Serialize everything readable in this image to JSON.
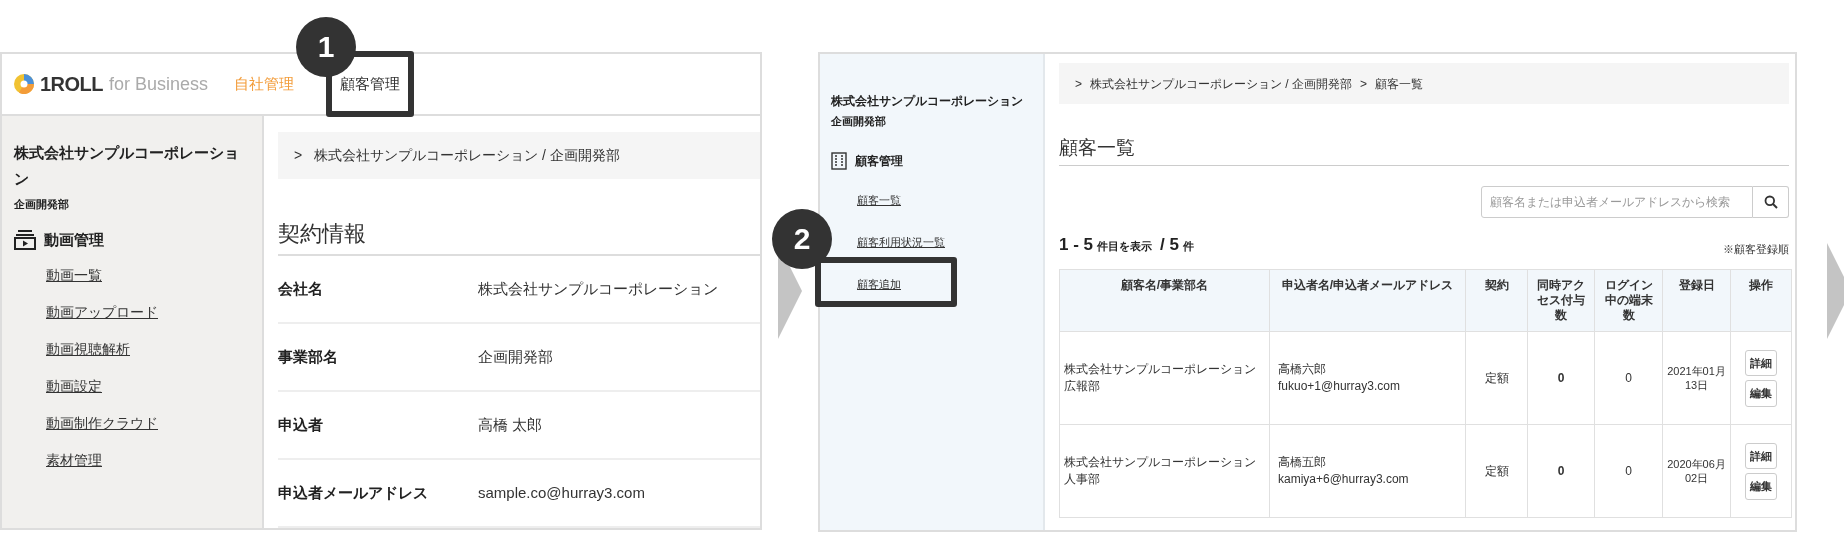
{
  "left_screen": {
    "header": {
      "logo_main": "1ROLL",
      "logo_suffix": "for Business",
      "nav": [
        {
          "label": "自社管理",
          "selected": true
        },
        {
          "label": "顧客管理",
          "selected": false,
          "callout": "1"
        }
      ]
    },
    "sidebar": {
      "company": "株式会社サンプルコーポレーション",
      "department": "企画開発部",
      "section": {
        "title": "動画管理",
        "items": [
          {
            "label": "動画一覧"
          },
          {
            "label": "動画アップロード"
          },
          {
            "label": "動画視聴解析"
          },
          {
            "label": "動画設定"
          },
          {
            "label": "動画制作クラウド"
          },
          {
            "label": "素材管理"
          }
        ]
      }
    },
    "breadcrumb": {
      "separator": ">",
      "items": [
        "株式会社サンプルコーポレーション / 企画開発部"
      ]
    },
    "title": "契約情報",
    "fields": [
      {
        "label": "会社名",
        "value": "株式会社サンプルコーポレーション"
      },
      {
        "label": "事業部名",
        "value": "企画開発部"
      },
      {
        "label": "申込者",
        "value": "高橋 太郎"
      },
      {
        "label": "申込者メールアドレス",
        "value": "sample.co@hurray3.com"
      }
    ]
  },
  "right_screen": {
    "sidebar": {
      "company": "株式会社サンプルコーポレーション",
      "department": "企画開発部",
      "section": {
        "title": "顧客管理",
        "items": [
          {
            "label": "顧客一覧"
          },
          {
            "label": "顧客利用状況一覧"
          },
          {
            "label": "顧客追加",
            "callout": "2"
          }
        ]
      }
    },
    "breadcrumb": {
      "separator": ">",
      "items": [
        "株式会社サンプルコーポレーション / 企画開発部",
        "顧客一覧"
      ]
    },
    "title": "顧客一覧",
    "search": {
      "placeholder": "顧客名または申込者メールアドレスから検索"
    },
    "count": {
      "range": "1 - 5",
      "range_suffix": "件目を表示",
      "total": "/ 5",
      "total_suffix": "件"
    },
    "sort_note": "※顧客登録順",
    "table": {
      "columns": [
        "顧客名/事業部名",
        "申込者名/申込者メールアドレス",
        "契約",
        "同時アクセス付与数",
        "ログイン中の端末数",
        "登録日",
        "操作"
      ],
      "rows": [
        {
          "customer": [
            "株式会社サンプルコーポレーション",
            "広報部"
          ],
          "applicant": [
            "高橋六郎",
            "fukuo+1@hurray3.com"
          ],
          "contract": "定額",
          "seats": "0",
          "devices": "0",
          "registered": "2021年01月13日",
          "actions": [
            "詳細",
            "編集"
          ]
        },
        {
          "customer": [
            "株式会社サンプルコーポレーション",
            "人事部"
          ],
          "applicant": [
            "高橋五郎",
            "kamiya+6@hurray3.com"
          ],
          "contract": "定額",
          "seats": "0",
          "devices": "0",
          "registered": "2020年06月02日",
          "actions": [
            "詳細",
            "編集"
          ]
        }
      ]
    }
  }
}
